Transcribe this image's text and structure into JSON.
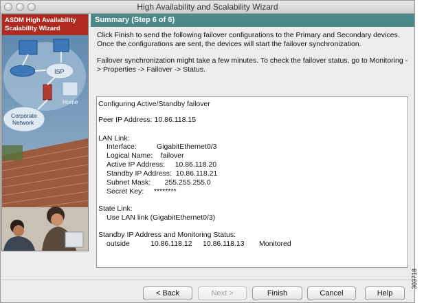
{
  "window": {
    "title": "High Availability and Scalability Wizard"
  },
  "sidebar": {
    "title_line1": "ASDM High Availability",
    "title_line2": "Scalability Wizard",
    "diagram_labels": {
      "isp": "ISP",
      "home": "Home",
      "corporate_line1": "Corporate",
      "corporate_line2": "Network"
    }
  },
  "header": {
    "title": "Summary (Step 6 of 6)"
  },
  "description": {
    "paragraph1": "Click Finish to send the following failover configurations to the Primary and Secondary devices. Once the configurations are sent, the devices will start the failover synchronization.",
    "paragraph2": "Failover synchronization might take a few minutes. To check the failover status, go to Monitoring -> Properties -> Failover -> Status."
  },
  "summary": {
    "heading": "Configuring Active/Standby failover",
    "peer_ip": "Peer IP Address: 10.86.118.15",
    "lan_link_heading": "LAN Link:",
    "lan_interface": "Interface:          GigabitEthernet0/3",
    "lan_logical_name": "Logical Name:    failover",
    "lan_active_ip": "Active IP Address:     10.86.118.20",
    "lan_standby_ip": "Standby IP Address:  10.86.118.21",
    "lan_subnet": "Subnet Mask:       255.255.255.0",
    "lan_secret": "Secret Key:     ********",
    "state_link_heading": "State Link:",
    "state_link_value": "Use LAN link (GigabitEthernet0/3)",
    "monitoring_heading": "Standby IP Address and Monitoring Status:",
    "monitoring_row": {
      "interface": "outside",
      "active_ip": "10.86.118.12",
      "standby_ip": "10.86.118.13",
      "status": "Monitored"
    }
  },
  "buttons": {
    "back": "< Back",
    "next": "Next >",
    "finish": "Finish",
    "cancel": "Cancel",
    "help": "Help"
  },
  "figure_code": "303718",
  "colors": {
    "sidebar_title_bg": "#b02a20",
    "header_bg": "#4c8a8a"
  }
}
